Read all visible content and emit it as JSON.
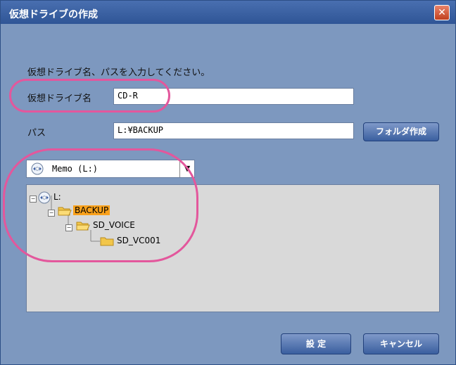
{
  "window": {
    "title": "仮想ドライブの作成",
    "close_glyph": "✕"
  },
  "instruction": "仮想ドライブ名、パスを入力してください。",
  "fields": {
    "drive_name_label": "仮想ドライブ名",
    "drive_name_value": "CD-R",
    "path_label": "パス",
    "path_value": "L:¥BACKUP"
  },
  "buttons": {
    "create_folder": "フォルダ作成",
    "ok": "設 定",
    "cancel": "キャンセル"
  },
  "drive_select": {
    "selected": "Memo (L:)",
    "arrow": "▼"
  },
  "tree": {
    "root": "L:",
    "child": "BACKUP",
    "grandchild": "SD_VOICE",
    "greatgrandchild": "SD_VC001"
  },
  "colors": {
    "window_bg": "#7d98bf",
    "title_bar": "#3a5e9f",
    "highlight": "#f9a11b",
    "annotation": "#e3579c"
  }
}
